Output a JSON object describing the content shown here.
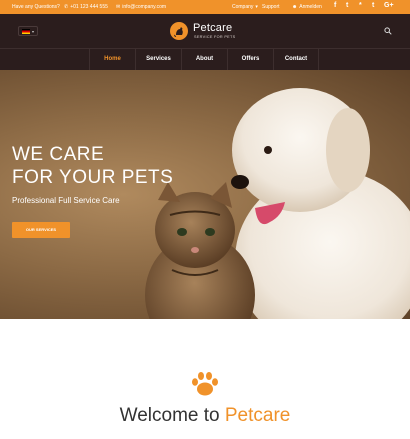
{
  "topbar": {
    "questions": "Have any Questions?",
    "phone": "+01 123 444 555",
    "email": "info@company.com",
    "company": "Company",
    "support": "Support",
    "account": "Anmelden",
    "social": [
      "f",
      "t",
      "*",
      "t",
      "G+"
    ]
  },
  "header": {
    "logo_title": "Petcare",
    "logo_subtitle": "SERVICE FOR PETS"
  },
  "nav": {
    "items": [
      "Home",
      "Services",
      "About",
      "Offers",
      "Contact"
    ]
  },
  "hero": {
    "title_line1": "WE CARE",
    "title_line2": "FOR YOUR PETS",
    "subtitle": "Professional Full Service Care",
    "button": "OUR SERVICES"
  },
  "welcome": {
    "prefix": "Welcome to ",
    "highlight": "Petcare"
  },
  "colors": {
    "accent": "#f0922a",
    "header": "#2b1d1d"
  }
}
